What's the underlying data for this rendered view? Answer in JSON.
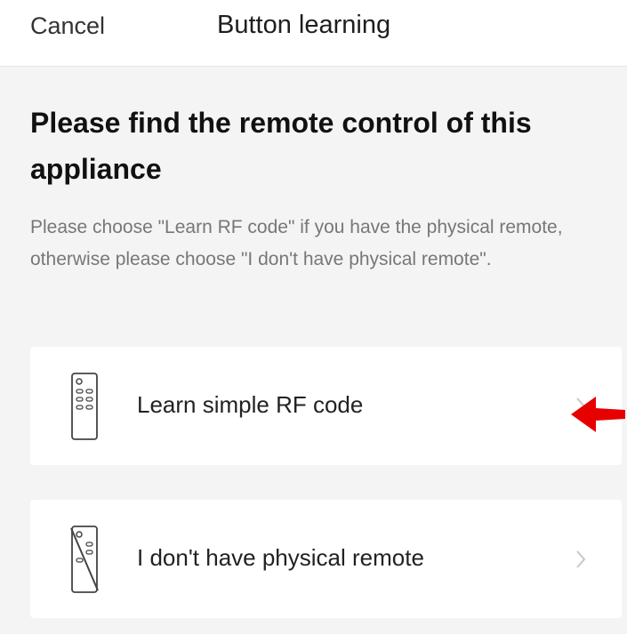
{
  "header": {
    "cancel_label": "Cancel",
    "title": "Button learning"
  },
  "main": {
    "heading": "Please find the remote control of this appliance",
    "description": "Please choose \"Learn RF code\" if you have the physical remote, otherwise please choose \"I don't have physical remote\"."
  },
  "options": [
    {
      "label": "Learn simple RF code",
      "icon": "remote-control-icon"
    },
    {
      "label": "I don't have physical remote",
      "icon": "no-remote-icon"
    }
  ],
  "annotation": {
    "icon": "red-arrow-icon",
    "color": "#e60000"
  },
  "colors": {
    "background": "#f4f4f4",
    "card": "#ffffff",
    "text_primary": "#222222",
    "text_secondary": "#777777",
    "chevron": "#c8c8c8"
  }
}
